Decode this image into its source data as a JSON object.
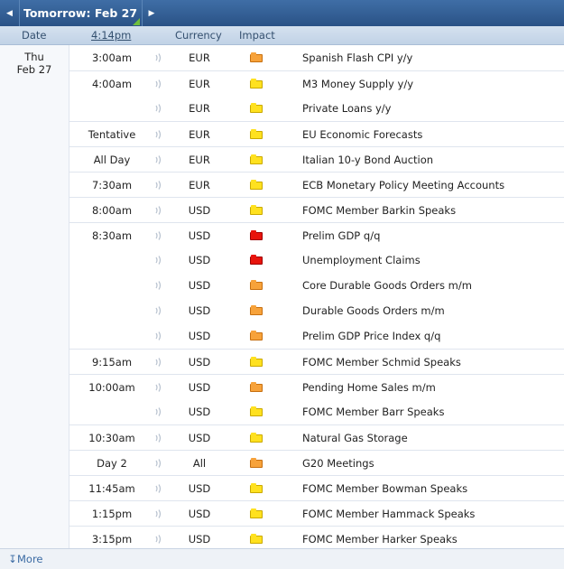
{
  "nav": {
    "title": "Tomorrow: Feb 27"
  },
  "header": {
    "date": "Date",
    "time": "4:14pm",
    "currency": "Currency",
    "impact": "Impact"
  },
  "day": {
    "weekday": "Thu",
    "date": "Feb 27"
  },
  "colors": {
    "low": "#ffe11f",
    "medium": "#f7a23a",
    "high": "#e8140c",
    "accent": "#2a5286"
  },
  "events": [
    {
      "time": "3:00am",
      "currency": "EUR",
      "impact": "medium",
      "event": "Spanish Flash CPI y/y"
    },
    {
      "time": "4:00am",
      "currency": "EUR",
      "impact": "low",
      "event": "M3 Money Supply y/y"
    },
    {
      "time": "",
      "currency": "EUR",
      "impact": "low",
      "event": "Private Loans y/y"
    },
    {
      "time": "Tentative",
      "currency": "EUR",
      "impact": "low",
      "event": "EU Economic Forecasts"
    },
    {
      "time": "All Day",
      "currency": "EUR",
      "impact": "low",
      "event": "Italian 10-y Bond Auction"
    },
    {
      "time": "7:30am",
      "currency": "EUR",
      "impact": "low",
      "event": "ECB Monetary Policy Meeting Accounts"
    },
    {
      "time": "8:00am",
      "currency": "USD",
      "impact": "low",
      "event": "FOMC Member Barkin Speaks"
    },
    {
      "time": "8:30am",
      "currency": "USD",
      "impact": "high",
      "event": "Prelim GDP q/q"
    },
    {
      "time": "",
      "currency": "USD",
      "impact": "high",
      "event": "Unemployment Claims"
    },
    {
      "time": "",
      "currency": "USD",
      "impact": "medium",
      "event": "Core Durable Goods Orders m/m"
    },
    {
      "time": "",
      "currency": "USD",
      "impact": "medium",
      "event": "Durable Goods Orders m/m"
    },
    {
      "time": "",
      "currency": "USD",
      "impact": "medium",
      "event": "Prelim GDP Price Index q/q"
    },
    {
      "time": "9:15am",
      "currency": "USD",
      "impact": "low",
      "event": "FOMC Member Schmid Speaks"
    },
    {
      "time": "10:00am",
      "currency": "USD",
      "impact": "medium",
      "event": "Pending Home Sales m/m"
    },
    {
      "time": "",
      "currency": "USD",
      "impact": "low",
      "event": "FOMC Member Barr Speaks"
    },
    {
      "time": "10:30am",
      "currency": "USD",
      "impact": "low",
      "event": "Natural Gas Storage"
    },
    {
      "time": "Day 2",
      "currency": "All",
      "impact": "medium",
      "event": "G20 Meetings"
    },
    {
      "time": "11:45am",
      "currency": "USD",
      "impact": "low",
      "event": "FOMC Member Bowman Speaks"
    },
    {
      "time": "1:15pm",
      "currency": "USD",
      "impact": "low",
      "event": "FOMC Member Hammack Speaks"
    },
    {
      "time": "3:15pm",
      "currency": "USD",
      "impact": "low",
      "event": "FOMC Member Harker Speaks"
    }
  ],
  "footer": {
    "more": "More"
  }
}
